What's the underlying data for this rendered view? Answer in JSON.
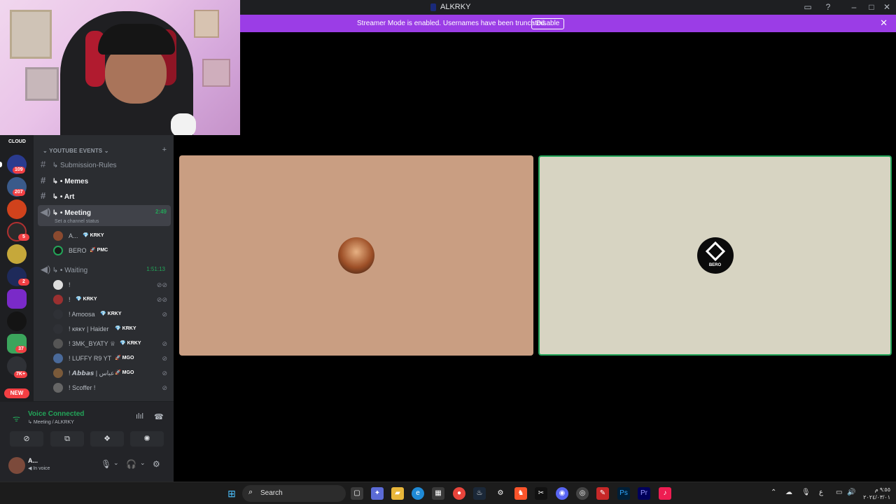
{
  "window": {
    "title": "ALKRKY",
    "buttons": [
      "inbox-icon",
      "help-icon",
      "minimize",
      "maximize",
      "close"
    ]
  },
  "streamer_banner": {
    "message": "Streamer Mode is enabled. Usernames have been truncated.",
    "disable_label": "Disable",
    "color": "#9b3de6"
  },
  "servers": {
    "cloud_label": "CLOUD",
    "badges": [
      "109",
      "207",
      "5",
      "2",
      "37",
      "7K+"
    ],
    "new_label": "NEW"
  },
  "channels": {
    "category": "YOUTUBE EVENTS",
    "items": [
      {
        "name": "Submission-Rules",
        "type": "text"
      },
      {
        "name": "Memes",
        "type": "text"
      },
      {
        "name": "Art",
        "type": "text"
      },
      {
        "name": "Meeting",
        "type": "voice",
        "time": "2:49",
        "status": "Set a channel status"
      }
    ],
    "meeting_users": [
      {
        "name": "A...",
        "tag": "KRKY"
      },
      {
        "name": "BERO",
        "tag": "PMC"
      }
    ],
    "waiting_channel": {
      "name": "Waiting",
      "time": "1:51:13"
    },
    "waiting_users": [
      {
        "name": "!",
        "tag": ""
      },
      {
        "name": "!",
        "tag": "KRKY"
      },
      {
        "name": "! Amoosa",
        "tag": "KRKY"
      },
      {
        "name": "! ĸʀĸʏ | Haider",
        "tag": "KRKY"
      },
      {
        "name": "! 3MK_BYATY ♕",
        "tag": "KRKY"
      },
      {
        "name": "! LUFFY R9 YT",
        "tag": "MGO"
      },
      {
        "name": "! 𝘼𝙗𝙗𝙖𝙨 | عباس",
        "tag": "MGO"
      },
      {
        "name": "! Scoffer !",
        "tag": ""
      }
    ]
  },
  "voice_panel": {
    "title": "Voice Connected",
    "subtitle": "Meeting / ALKRKY"
  },
  "user_panel": {
    "name": "A...",
    "status": "In voice"
  },
  "stage": {
    "tile_two_label": "BERO",
    "accent": "#23a559"
  },
  "taskbar": {
    "search_label": "Search",
    "lang": "ع",
    "time": "٩:٥٥ م",
    "date": "٢٠٢٤/٠٣/٠١"
  }
}
